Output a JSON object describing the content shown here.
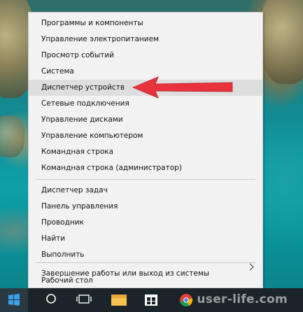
{
  "menu": {
    "group1": [
      "Программы и компоненты",
      "Управление электропитанием",
      "Просмотр событий",
      "Система",
      "Диспетчер устройств",
      "Сетевые подключения",
      "Управление дисками",
      "Управление компьютером",
      "Командная строка",
      "Командная строка (администратор)"
    ],
    "group2": [
      "Диспетчер задач",
      "Панель управления",
      "Проводник",
      "Найти",
      "Выполнить"
    ],
    "group3": [
      "Завершение работы или выход из системы",
      "Рабочий стол"
    ],
    "highlighted_item": "Диспетчер устройств"
  },
  "colors": {
    "arrow": "#e8333c",
    "menu_background": "#f2f2f2",
    "taskbar": "#1b2428",
    "start_logo": "#3aa0ea"
  },
  "taskbar": {
    "icons": [
      "windows-start-icon",
      "search-icon",
      "task-view-icon",
      "file-explorer-icon",
      "store-icon",
      "chrome-icon"
    ]
  },
  "watermark": "user-life.com"
}
